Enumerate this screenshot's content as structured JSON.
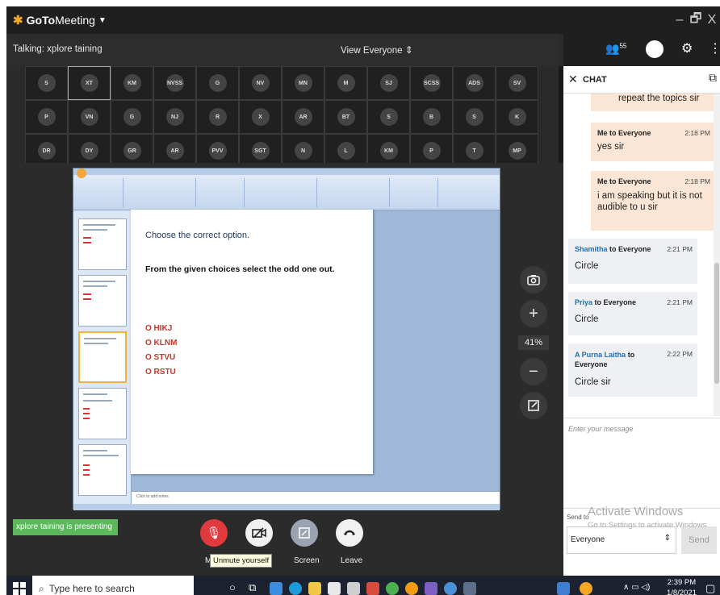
{
  "app": {
    "brand_goto": "GoTo",
    "brand_meeting": "Meeting"
  },
  "window": {
    "minimize": "–",
    "restore": "🗗",
    "close": "X"
  },
  "infobar": {
    "talking": "Talking: xplore taining",
    "view": "View Everyone"
  },
  "attendee_count": "55",
  "grid": [
    [
      "S",
      "XT",
      "KM",
      "NVSS",
      "G",
      "NV",
      "MN",
      "M",
      "SJ",
      "SCSS",
      "ADS",
      "SV"
    ],
    [
      "P",
      "VN",
      "G",
      "NJ",
      "R",
      "X",
      "AR",
      "BT",
      "S",
      "B",
      "S",
      "K"
    ],
    [
      "DR",
      "DY",
      "GR",
      "AR",
      "PVV",
      "SGT",
      "N",
      "L",
      "KM",
      "P",
      "T",
      "MP"
    ]
  ],
  "slide": {
    "title": "Choose the correct option.",
    "question": "From the given choices select the odd one out.",
    "options": [
      "O HIKJ",
      "O KLNM",
      "O STVU",
      "O RSTU"
    ],
    "notes": "Click to add notes"
  },
  "view_tools": {
    "zoom": "41%"
  },
  "chat": {
    "header": "CHAT",
    "messages": [
      {
        "from": "",
        "to": "",
        "time": "",
        "text": "repeat the topics sir",
        "mine": true
      },
      {
        "from": "Me",
        "to": "to Everyone",
        "time": "2:18 PM",
        "text": "yes sir",
        "mine": true
      },
      {
        "from": "Me",
        "to": "to Everyone",
        "time": "2:18 PM",
        "text": "i am speaking but it is not audible to u sir",
        "mine": true
      },
      {
        "from": "Shamitha",
        "to": "to Everyone",
        "time": "2:21 PM",
        "text": "Circle",
        "mine": false
      },
      {
        "from": "Priya",
        "to": "to Everyone",
        "time": "2:21 PM",
        "text": "Circle",
        "mine": false
      },
      {
        "from": "A Purna Laitha",
        "to": "to Everyone",
        "time": "2:22 PM",
        "text": "Circle sir",
        "mine": false
      }
    ],
    "input_placeholder": "Enter your message",
    "send_to_label": "Send to",
    "send_to_value": "Everyone",
    "send_button": "Send",
    "activate_title": "Activate Windows",
    "activate_sub": "Go to Settings to activate Windows."
  },
  "bottom": {
    "presenting": "xplore taining is presenting",
    "mic_label": "M",
    "cam_label": "a",
    "screen_label": "Screen",
    "leave_label": "Leave",
    "tooltip": "Unmute yourself"
  },
  "taskbar": {
    "search_placeholder": "Type here to search",
    "time": "2:39 PM",
    "date": "1/8/2021"
  },
  "colors": {
    "brand": "#f5a623",
    "mic_red": "#e0393e",
    "presenting_green": "#5cb85c",
    "chat_mine": "#fbe6d5",
    "option_red": "#c0392b"
  }
}
